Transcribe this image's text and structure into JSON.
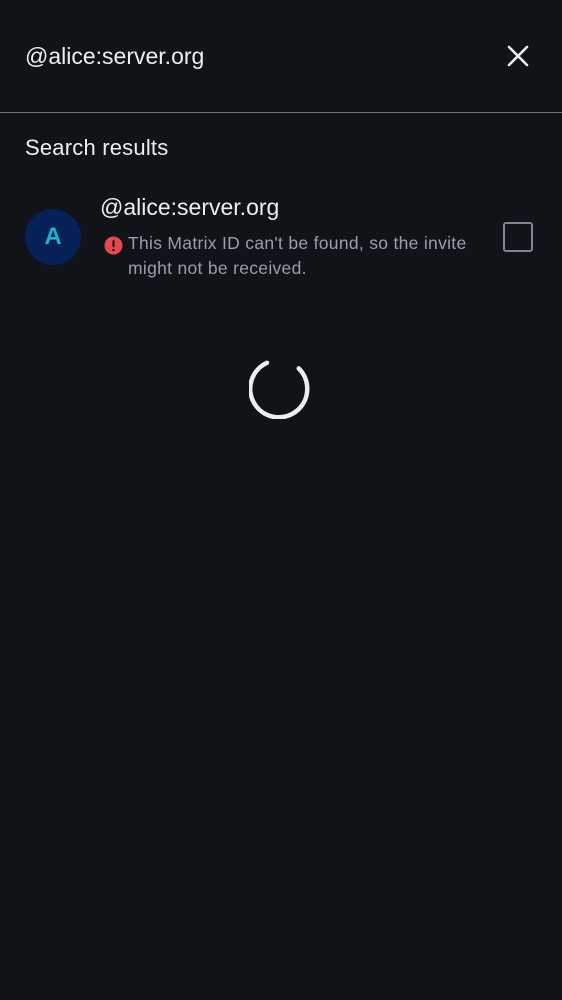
{
  "search": {
    "query": "@alice:server.org",
    "close_icon": "close-icon"
  },
  "results": {
    "title": "Search results",
    "items": [
      {
        "avatar_letter": "A",
        "name": "@alice:server.org",
        "warning": "This Matrix ID can't be found, so the invite might not be received.",
        "warning_icon": "error-icon",
        "selected": false
      }
    ]
  },
  "colors": {
    "background": "#101318",
    "text_primary": "#ebeef2",
    "text_secondary": "#9a9fa8",
    "avatar_bg": "#062058",
    "avatar_fg": "#1ab2cf",
    "error": "#e5484d",
    "divider": "#6b7078"
  },
  "loading": true
}
